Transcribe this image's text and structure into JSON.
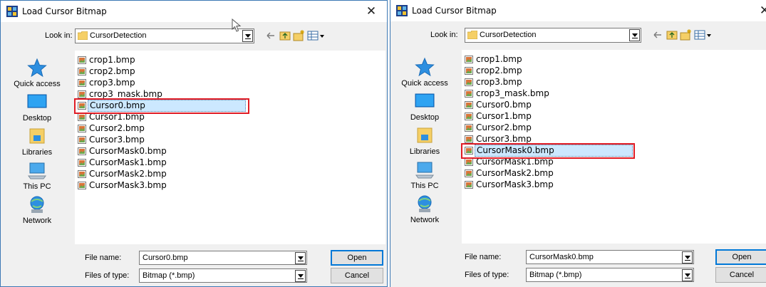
{
  "dialogs": [
    {
      "title": "Load Cursor Bitmap",
      "look_in_label": "Look in:",
      "look_in_value": "CursorDetection",
      "places": [
        "Quick access",
        "Desktop",
        "Libraries",
        "This PC",
        "Network"
      ],
      "files": [
        "crop1.bmp",
        "crop2.bmp",
        "crop3.bmp",
        "crop3_mask.bmp",
        "Cursor0.bmp",
        "Cursor1.bmp",
        "Cursor2.bmp",
        "Cursor3.bmp",
        "CursorMask0.bmp",
        "CursorMask1.bmp",
        "CursorMask2.bmp",
        "CursorMask3.bmp"
      ],
      "selected_file": "Cursor0.bmp",
      "file_name_label": "File name:",
      "file_name_value": "Cursor0.bmp",
      "file_type_label": "Files of type:",
      "file_type_value": "Bitmap (*.bmp)",
      "open_label": "Open",
      "cancel_label": "Cancel"
    },
    {
      "title": "Load Cursor Bitmap",
      "look_in_label": "Look in:",
      "look_in_value": "CursorDetection",
      "places": [
        "Quick access",
        "Desktop",
        "Libraries",
        "This PC",
        "Network"
      ],
      "files": [
        "crop1.bmp",
        "crop2.bmp",
        "crop3.bmp",
        "crop3_mask.bmp",
        "Cursor0.bmp",
        "Cursor1.bmp",
        "Cursor2.bmp",
        "Cursor3.bmp",
        "CursorMask0.bmp",
        "CursorMask1.bmp",
        "CursorMask2.bmp",
        "CursorMask3.bmp"
      ],
      "selected_file": "CursorMask0.bmp",
      "file_name_label": "File name:",
      "file_name_value": "CursorMask0.bmp",
      "file_type_label": "Files of type:",
      "file_type_value": "Bitmap (*.bmp)",
      "open_label": "Open",
      "cancel_label": "Cancel"
    }
  ],
  "colors": {
    "highlight_box": "#e01b24",
    "selection_fill": "#cce8ff",
    "window_border": "#3c78b4"
  },
  "icons": {
    "app": "app-icon",
    "close": "close-icon",
    "folder": "folder-icon",
    "back": "back-arrow-icon",
    "up": "up-folder-icon",
    "new_folder": "new-folder-icon",
    "view_menu": "view-menu-icon",
    "bitmap_file": "bitmap-file-icon"
  }
}
